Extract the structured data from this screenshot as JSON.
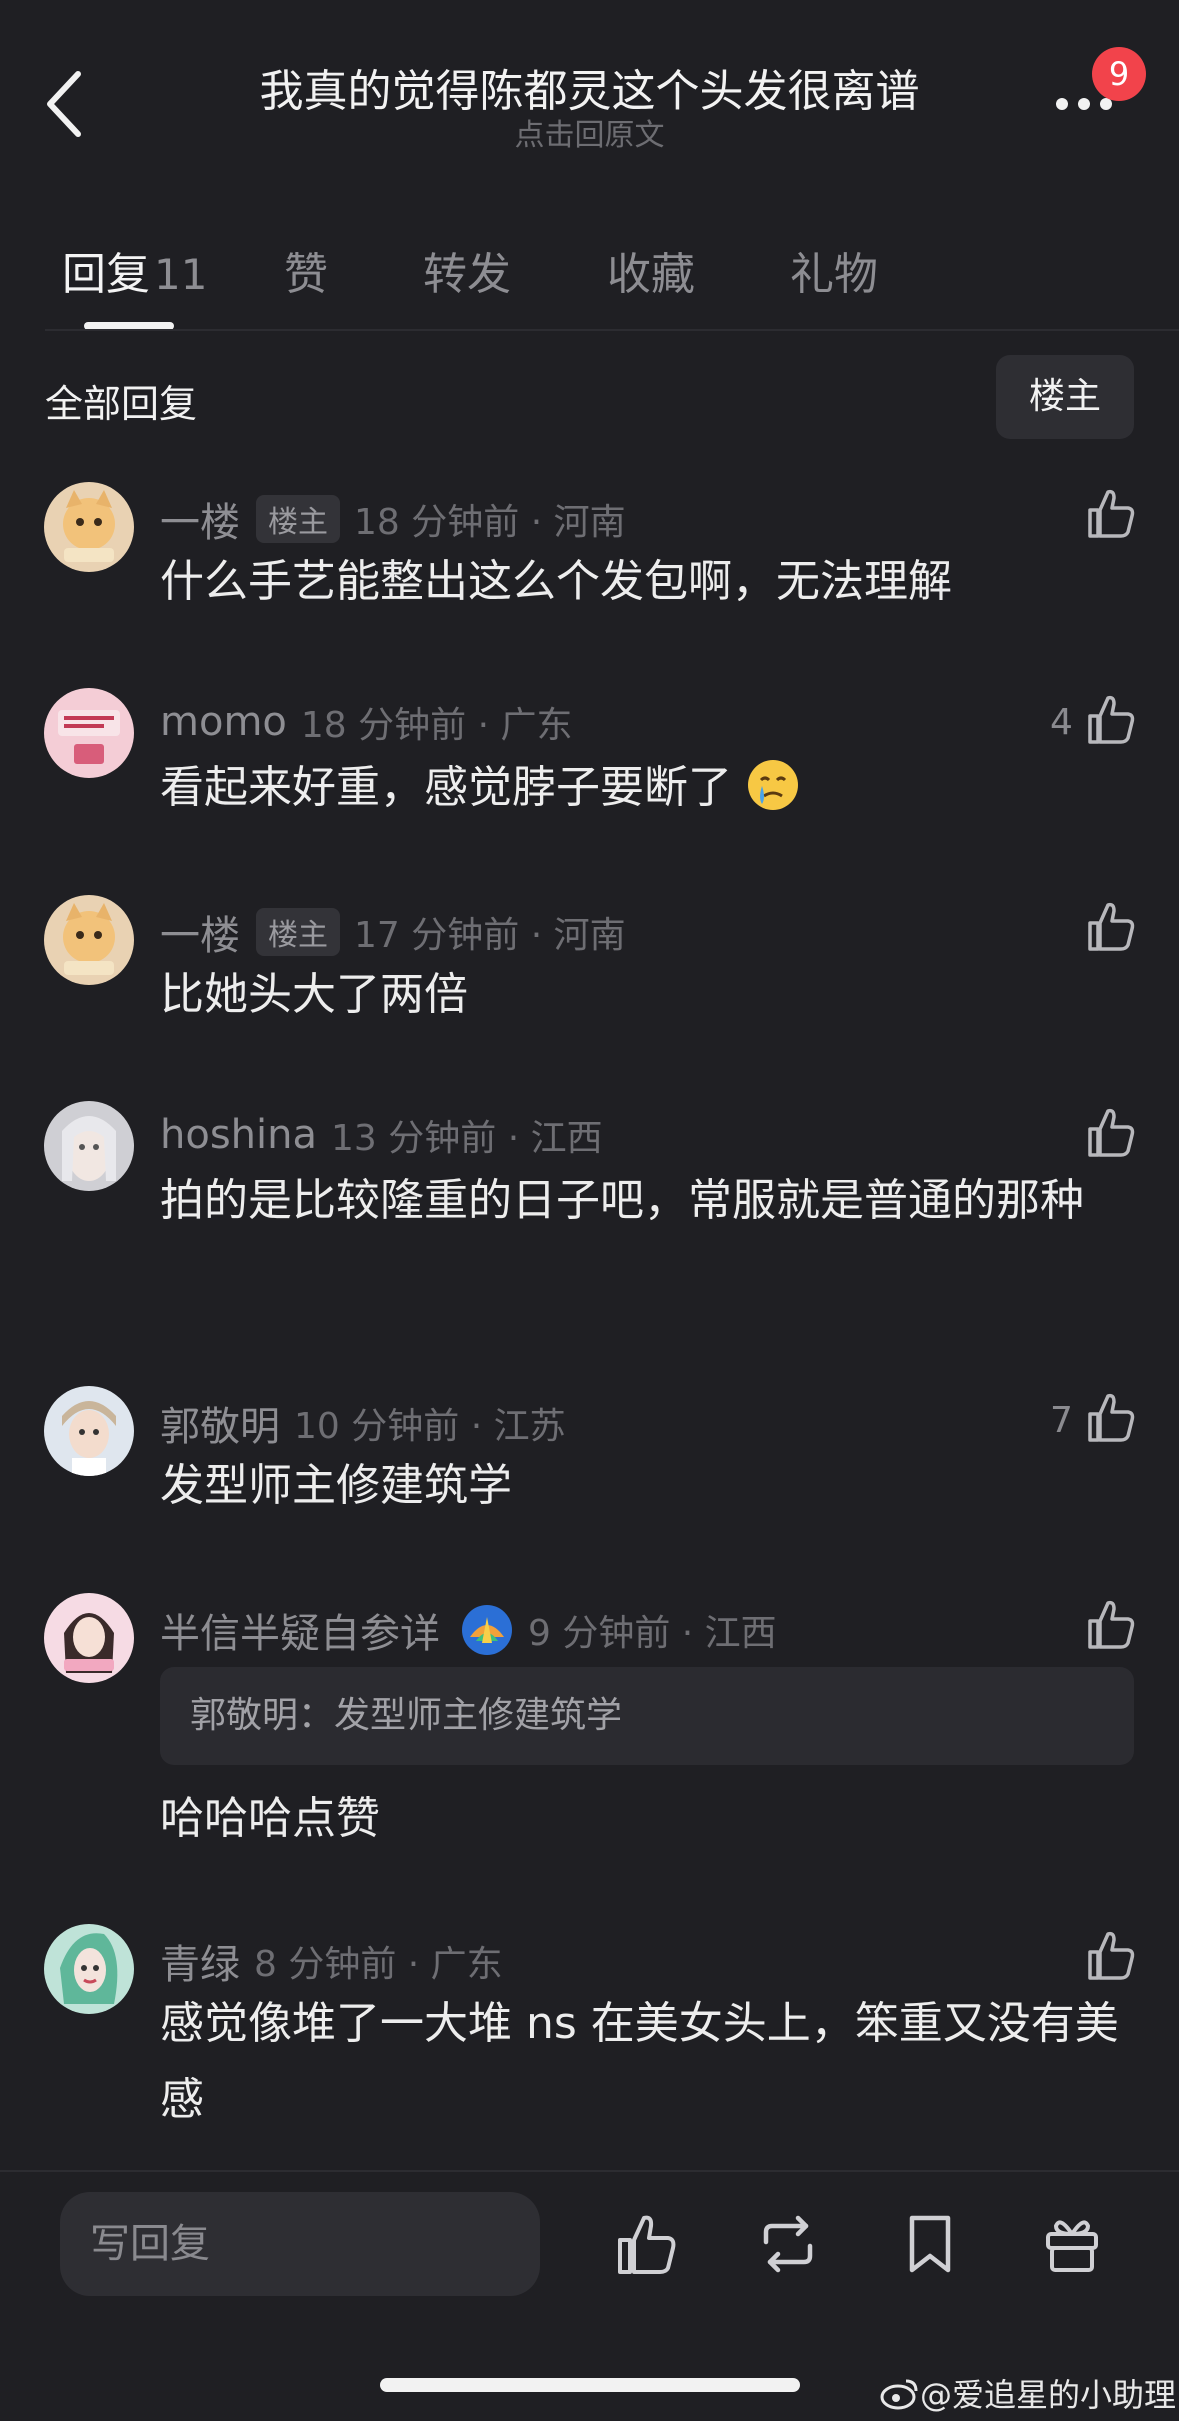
{
  "header": {
    "title": "我真的觉得陈都灵这个头发很离谱",
    "subtitle": "点击回原文",
    "badge_count": "9"
  },
  "tabs": [
    {
      "label": "回复",
      "count": "11",
      "active": true
    },
    {
      "label": "赞"
    },
    {
      "label": "转发"
    },
    {
      "label": "收藏"
    },
    {
      "label": "礼物"
    }
  ],
  "filter": {
    "label": "全部回复",
    "op_button": "楼主"
  },
  "comments": [
    {
      "name": "一楼",
      "owner_tag": "楼主",
      "time": "18 分钟前 · 河南",
      "body": "什么手艺能整出这么个发包啊，无法理解",
      "likes": ""
    },
    {
      "name": "momo",
      "time": "18 分钟前 · 广东",
      "body": "看起来好重，感觉脖子要断了",
      "likes": "4"
    },
    {
      "name": "一楼",
      "owner_tag": "楼主",
      "time": "17 分钟前 · 河南",
      "body": "比她头大了两倍",
      "likes": ""
    },
    {
      "name": "hoshina",
      "time": "13 分钟前 · 江西",
      "body": "拍的是比较隆重的日子吧，常服就是普通的那种",
      "likes": ""
    },
    {
      "name": "郭敬明",
      "time": "10 分钟前 · 江苏",
      "body": "发型师主修建筑学",
      "likes": "7"
    },
    {
      "name": "半信半疑自参详",
      "time": "9 分钟前 · 江西",
      "quote": "郭敬明：发型师主修建筑学",
      "body": "哈哈哈点赞",
      "likes": ""
    },
    {
      "name": "青绿",
      "time": "8 分钟前 · 广东",
      "body": "感觉像堆了一大堆 ns 在美女头上，笨重又没有美感",
      "likes": ""
    }
  ],
  "bottom_bar": {
    "input_placeholder": "写回复"
  },
  "watermark": "@爱追星的小助理",
  "colors": {
    "background": "#1f1f23",
    "badge": "#f2434b",
    "text": "#ededed",
    "muted": "#8a8a8f"
  }
}
